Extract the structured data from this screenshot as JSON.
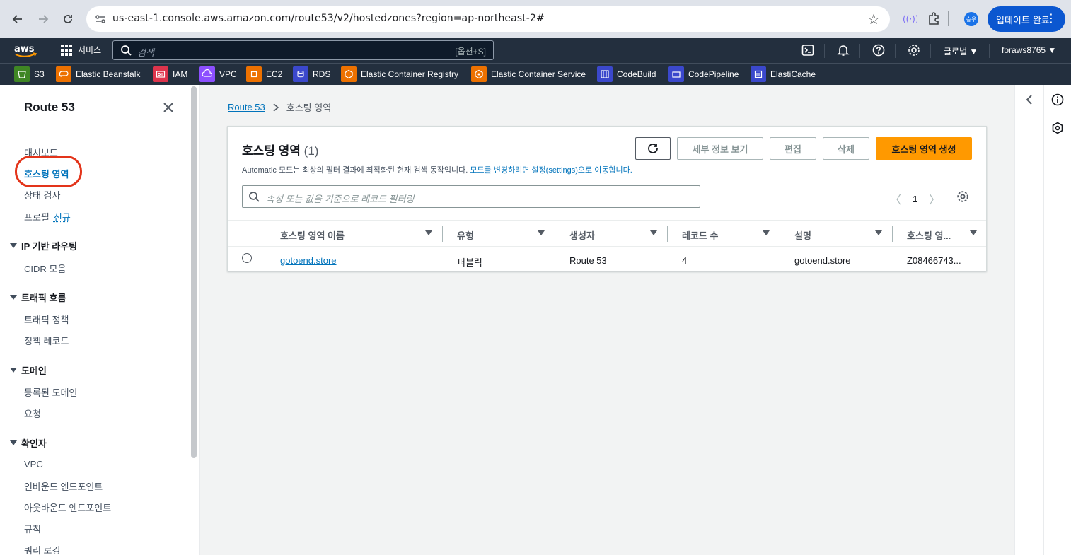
{
  "browser": {
    "url": "us-east-1.console.aws.amazon.com/route53/v2/hostedzones?region=ap-northeast-2#",
    "profile_initials": "승우",
    "update_button_label": "업데이트 완료"
  },
  "aws_nav": {
    "services_label": "서비스",
    "search_placeholder": "검색",
    "search_shortcut": "[옵션+S]",
    "region_label": "글로벌",
    "account_label": "foraws8765"
  },
  "favorites": [
    {
      "label": "S3",
      "color": "#3f8624"
    },
    {
      "label": "Elastic Beanstalk",
      "color": "#ed7100"
    },
    {
      "label": "IAM",
      "color": "#dd344c"
    },
    {
      "label": "VPC",
      "color": "#8c4fff"
    },
    {
      "label": "EC2",
      "color": "#ed7100"
    },
    {
      "label": "RDS",
      "color": "#3b48cc"
    },
    {
      "label": "Elastic Container Registry",
      "color": "#ed7100"
    },
    {
      "label": "Elastic Container Service",
      "color": "#ed7100"
    },
    {
      "label": "CodeBuild",
      "color": "#3b48cc"
    },
    {
      "label": "CodePipeline",
      "color": "#3b48cc"
    },
    {
      "label": "ElastiCache",
      "color": "#3b48cc"
    }
  ],
  "sidebar": {
    "title": "Route 53",
    "links": {
      "dashboard": "대시보드",
      "hosted_zones": "호스팅 영역",
      "health_checks": "상태 검사",
      "profiles": "프로필",
      "profiles_badge": "신규"
    },
    "sections": [
      {
        "title": "IP 기반 라우팅",
        "items": [
          "CIDR 모음"
        ]
      },
      {
        "title": "트래픽 흐름",
        "items": [
          "트래픽 정책",
          "정책 레코드"
        ]
      },
      {
        "title": "도메인",
        "items": [
          "등록된 도메인",
          "요청"
        ]
      },
      {
        "title": "확인자",
        "items": [
          "VPC",
          "인바운드 엔드포인트",
          "아웃바운드 엔드포인트",
          "규칙",
          "쿼리 로깅"
        ]
      }
    ]
  },
  "breadcrumb": {
    "root": "Route 53",
    "current": "호스팅 영역"
  },
  "panel": {
    "title": "호스팅 영역",
    "count": "(1)",
    "description": "Automatic 모드는 최상의 필터 결과에 최적화된 현재 검색 동작입니다.",
    "description_link": "모드를 변경하려면 설정(settings)으로 이동합니다.",
    "buttons": {
      "view_details": "세부 정보 보기",
      "edit": "편집",
      "delete": "삭제",
      "create": "호스팅 영역 생성"
    },
    "filter_placeholder": "속성 또는 값을 기준으로 레코드 필터링",
    "page": "1"
  },
  "table": {
    "columns": [
      "호스팅 영역 이름",
      "유형",
      "생성자",
      "레코드 수",
      "설명",
      "호스팅 영..."
    ],
    "rows": [
      [
        "gotoend.store",
        "퍼블릭",
        "Route 53",
        "4",
        "gotoend.store",
        "Z08466743..."
      ]
    ]
  }
}
